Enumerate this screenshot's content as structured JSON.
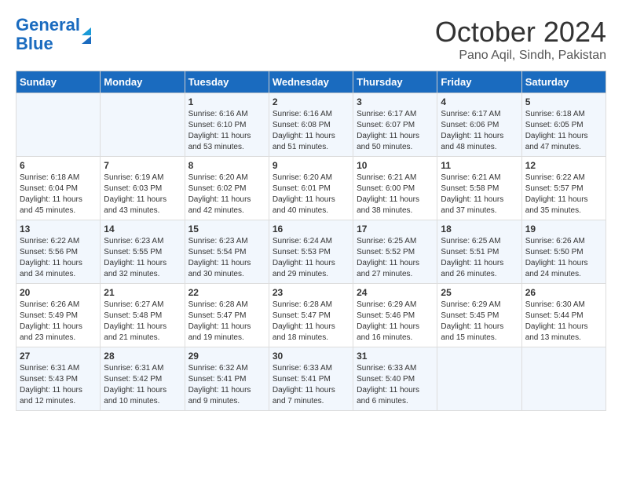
{
  "header": {
    "logo_line1": "General",
    "logo_line2": "Blue",
    "month": "October 2024",
    "location": "Pano Aqil, Sindh, Pakistan"
  },
  "weekdays": [
    "Sunday",
    "Monday",
    "Tuesday",
    "Wednesday",
    "Thursday",
    "Friday",
    "Saturday"
  ],
  "weeks": [
    [
      {
        "day": "",
        "sunrise": "",
        "sunset": "",
        "daylight": ""
      },
      {
        "day": "",
        "sunrise": "",
        "sunset": "",
        "daylight": ""
      },
      {
        "day": "1",
        "sunrise": "Sunrise: 6:16 AM",
        "sunset": "Sunset: 6:10 PM",
        "daylight": "Daylight: 11 hours and 53 minutes."
      },
      {
        "day": "2",
        "sunrise": "Sunrise: 6:16 AM",
        "sunset": "Sunset: 6:08 PM",
        "daylight": "Daylight: 11 hours and 51 minutes."
      },
      {
        "day": "3",
        "sunrise": "Sunrise: 6:17 AM",
        "sunset": "Sunset: 6:07 PM",
        "daylight": "Daylight: 11 hours and 50 minutes."
      },
      {
        "day": "4",
        "sunrise": "Sunrise: 6:17 AM",
        "sunset": "Sunset: 6:06 PM",
        "daylight": "Daylight: 11 hours and 48 minutes."
      },
      {
        "day": "5",
        "sunrise": "Sunrise: 6:18 AM",
        "sunset": "Sunset: 6:05 PM",
        "daylight": "Daylight: 11 hours and 47 minutes."
      }
    ],
    [
      {
        "day": "6",
        "sunrise": "Sunrise: 6:18 AM",
        "sunset": "Sunset: 6:04 PM",
        "daylight": "Daylight: 11 hours and 45 minutes."
      },
      {
        "day": "7",
        "sunrise": "Sunrise: 6:19 AM",
        "sunset": "Sunset: 6:03 PM",
        "daylight": "Daylight: 11 hours and 43 minutes."
      },
      {
        "day": "8",
        "sunrise": "Sunrise: 6:20 AM",
        "sunset": "Sunset: 6:02 PM",
        "daylight": "Daylight: 11 hours and 42 minutes."
      },
      {
        "day": "9",
        "sunrise": "Sunrise: 6:20 AM",
        "sunset": "Sunset: 6:01 PM",
        "daylight": "Daylight: 11 hours and 40 minutes."
      },
      {
        "day": "10",
        "sunrise": "Sunrise: 6:21 AM",
        "sunset": "Sunset: 6:00 PM",
        "daylight": "Daylight: 11 hours and 38 minutes."
      },
      {
        "day": "11",
        "sunrise": "Sunrise: 6:21 AM",
        "sunset": "Sunset: 5:58 PM",
        "daylight": "Daylight: 11 hours and 37 minutes."
      },
      {
        "day": "12",
        "sunrise": "Sunrise: 6:22 AM",
        "sunset": "Sunset: 5:57 PM",
        "daylight": "Daylight: 11 hours and 35 minutes."
      }
    ],
    [
      {
        "day": "13",
        "sunrise": "Sunrise: 6:22 AM",
        "sunset": "Sunset: 5:56 PM",
        "daylight": "Daylight: 11 hours and 34 minutes."
      },
      {
        "day": "14",
        "sunrise": "Sunrise: 6:23 AM",
        "sunset": "Sunset: 5:55 PM",
        "daylight": "Daylight: 11 hours and 32 minutes."
      },
      {
        "day": "15",
        "sunrise": "Sunrise: 6:23 AM",
        "sunset": "Sunset: 5:54 PM",
        "daylight": "Daylight: 11 hours and 30 minutes."
      },
      {
        "day": "16",
        "sunrise": "Sunrise: 6:24 AM",
        "sunset": "Sunset: 5:53 PM",
        "daylight": "Daylight: 11 hours and 29 minutes."
      },
      {
        "day": "17",
        "sunrise": "Sunrise: 6:25 AM",
        "sunset": "Sunset: 5:52 PM",
        "daylight": "Daylight: 11 hours and 27 minutes."
      },
      {
        "day": "18",
        "sunrise": "Sunrise: 6:25 AM",
        "sunset": "Sunset: 5:51 PM",
        "daylight": "Daylight: 11 hours and 26 minutes."
      },
      {
        "day": "19",
        "sunrise": "Sunrise: 6:26 AM",
        "sunset": "Sunset: 5:50 PM",
        "daylight": "Daylight: 11 hours and 24 minutes."
      }
    ],
    [
      {
        "day": "20",
        "sunrise": "Sunrise: 6:26 AM",
        "sunset": "Sunset: 5:49 PM",
        "daylight": "Daylight: 11 hours and 23 minutes."
      },
      {
        "day": "21",
        "sunrise": "Sunrise: 6:27 AM",
        "sunset": "Sunset: 5:48 PM",
        "daylight": "Daylight: 11 hours and 21 minutes."
      },
      {
        "day": "22",
        "sunrise": "Sunrise: 6:28 AM",
        "sunset": "Sunset: 5:47 PM",
        "daylight": "Daylight: 11 hours and 19 minutes."
      },
      {
        "day": "23",
        "sunrise": "Sunrise: 6:28 AM",
        "sunset": "Sunset: 5:47 PM",
        "daylight": "Daylight: 11 hours and 18 minutes."
      },
      {
        "day": "24",
        "sunrise": "Sunrise: 6:29 AM",
        "sunset": "Sunset: 5:46 PM",
        "daylight": "Daylight: 11 hours and 16 minutes."
      },
      {
        "day": "25",
        "sunrise": "Sunrise: 6:29 AM",
        "sunset": "Sunset: 5:45 PM",
        "daylight": "Daylight: 11 hours and 15 minutes."
      },
      {
        "day": "26",
        "sunrise": "Sunrise: 6:30 AM",
        "sunset": "Sunset: 5:44 PM",
        "daylight": "Daylight: 11 hours and 13 minutes."
      }
    ],
    [
      {
        "day": "27",
        "sunrise": "Sunrise: 6:31 AM",
        "sunset": "Sunset: 5:43 PM",
        "daylight": "Daylight: 11 hours and 12 minutes."
      },
      {
        "day": "28",
        "sunrise": "Sunrise: 6:31 AM",
        "sunset": "Sunset: 5:42 PM",
        "daylight": "Daylight: 11 hours and 10 minutes."
      },
      {
        "day": "29",
        "sunrise": "Sunrise: 6:32 AM",
        "sunset": "Sunset: 5:41 PM",
        "daylight": "Daylight: 11 hours and 9 minutes."
      },
      {
        "day": "30",
        "sunrise": "Sunrise: 6:33 AM",
        "sunset": "Sunset: 5:41 PM",
        "daylight": "Daylight: 11 hours and 7 minutes."
      },
      {
        "day": "31",
        "sunrise": "Sunrise: 6:33 AM",
        "sunset": "Sunset: 5:40 PM",
        "daylight": "Daylight: 11 hours and 6 minutes."
      },
      {
        "day": "",
        "sunrise": "",
        "sunset": "",
        "daylight": ""
      },
      {
        "day": "",
        "sunrise": "",
        "sunset": "",
        "daylight": ""
      }
    ]
  ]
}
